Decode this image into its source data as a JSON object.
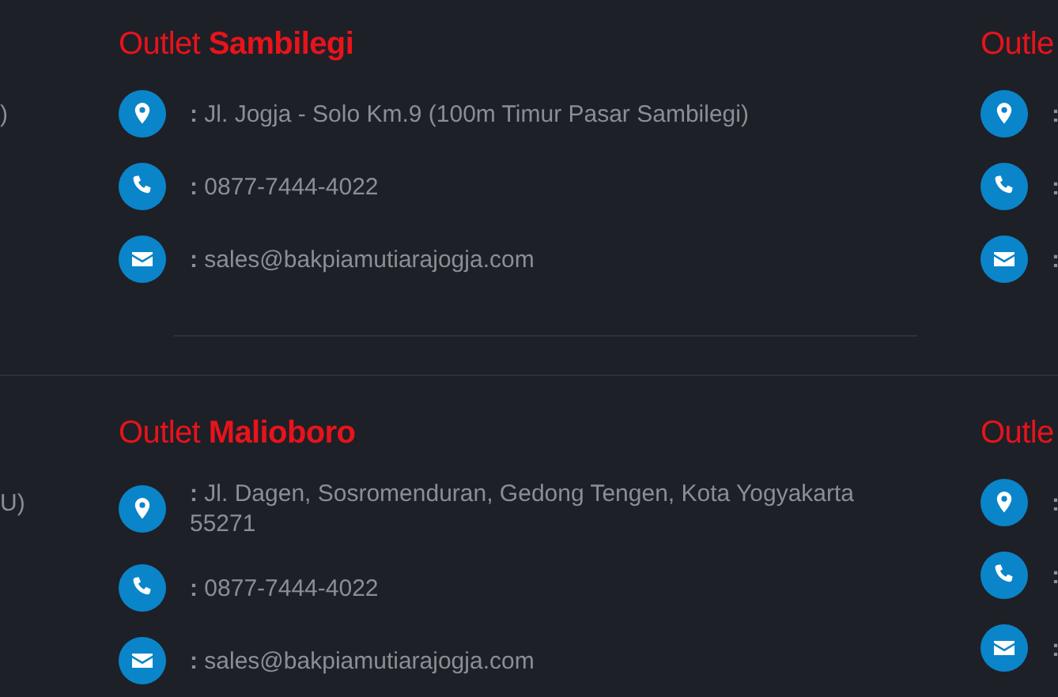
{
  "sections": [
    {
      "left_fragment": ")",
      "outlet": {
        "title_prefix": "Outlet",
        "title_name": "Sambilegi",
        "contacts": [
          {
            "kind": "address",
            "lines": [
              "**:** Jl. Jogja - Solo Km.9 (100m Timur Pasar Sambilegi)"
            ]
          },
          {
            "kind": "phone",
            "lines": [
              "**:** 0877-7444-4022"
            ]
          },
          {
            "kind": "email",
            "lines": [
              "**:** sales@bakpiamutiarajogja.com"
            ]
          }
        ]
      },
      "right": {
        "title": "Outle",
        "contacts": [
          {
            "kind": "address",
            "text": ":"
          },
          {
            "kind": "phone",
            "text": ":"
          },
          {
            "kind": "email",
            "text": ":"
          }
        ]
      }
    },
    {
      "left_fragment": "U)",
      "outlet": {
        "title_prefix": "Outlet",
        "title_name": "Malioboro",
        "contacts": [
          {
            "kind": "address",
            "lines": [
              "**:** Jl. Dagen, Sosromenduran, Gedong Tengen, Kota Yogyakarta",
              "55271"
            ]
          },
          {
            "kind": "phone",
            "lines": [
              "**:** 0877-7444-4022"
            ]
          },
          {
            "kind": "email",
            "lines": [
              "**:** sales@bakpiamutiarajogja.com"
            ]
          }
        ]
      },
      "right": {
        "title": "Outle",
        "contacts": [
          {
            "kind": "address",
            "text": ":"
          },
          {
            "kind": "phone",
            "text": ":"
          },
          {
            "kind": "email",
            "text": ":"
          }
        ]
      }
    }
  ]
}
